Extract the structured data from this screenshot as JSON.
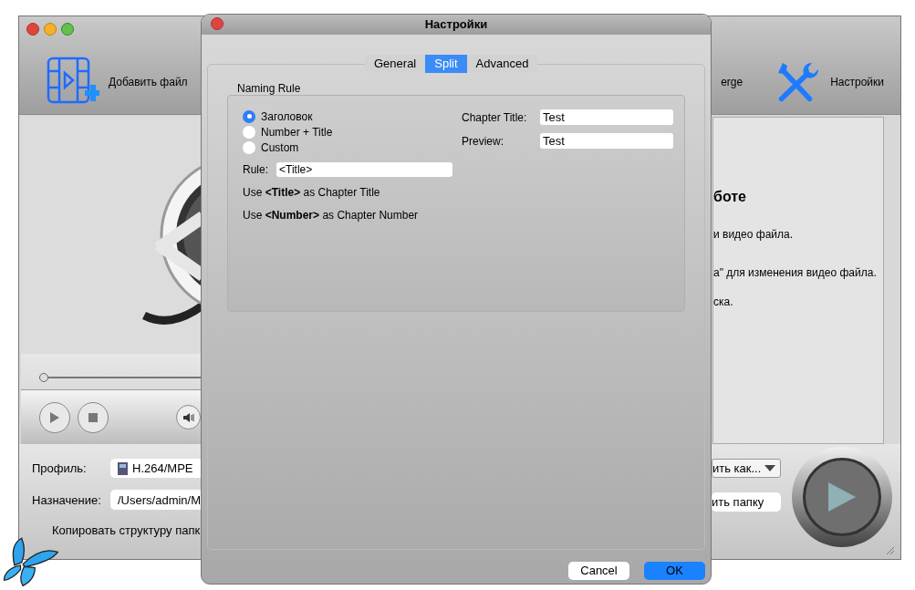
{
  "main_window": {
    "toolbar": [
      {
        "kind": "add-file",
        "label": "Добавить файл"
      },
      {
        "kind": "merge",
        "label": "erge"
      },
      {
        "kind": "settings",
        "label": "Настройки"
      }
    ],
    "seek": {
      "level": 0
    },
    "info_panel": {
      "heading": "боте",
      "lines": [
        "и видео файла.",
        "а\" для изменения видео файла.",
        "ска."
      ]
    },
    "profile": {
      "label": "Профиль:",
      "value": "H.264/MPE"
    },
    "destination": {
      "label": "Назначение:",
      "value": "/Users/admin/M"
    },
    "copy_structure": {
      "label": "Копировать структуру папк"
    },
    "save_as": {
      "label": "ить как..."
    },
    "open_folder": {
      "label": "ить папку"
    }
  },
  "dialog": {
    "title": "Настройки",
    "tabs": [
      {
        "label": "General",
        "selected": false
      },
      {
        "label": "Split",
        "selected": true
      },
      {
        "label": "Advanced",
        "selected": false
      }
    ],
    "group_title": "Naming Rule",
    "rules": [
      {
        "label": "Заголовок",
        "selected": true
      },
      {
        "label": "Number + Title",
        "selected": false
      },
      {
        "label": "Custom",
        "selected": false
      }
    ],
    "rule": {
      "label": "Rule:",
      "value": "<Title>"
    },
    "hints": [
      "Use **<Title>** as Chapter Title",
      "Use **<Number>** as Chapter Number"
    ],
    "chapter_title": {
      "label": "Chapter Title:",
      "value": "Test"
    },
    "preview": {
      "label": "Preview:",
      "value": "Test"
    },
    "buttons": [
      {
        "kind": "cancel",
        "label": "Cancel"
      },
      {
        "kind": "default",
        "label": "OK"
      }
    ]
  }
}
